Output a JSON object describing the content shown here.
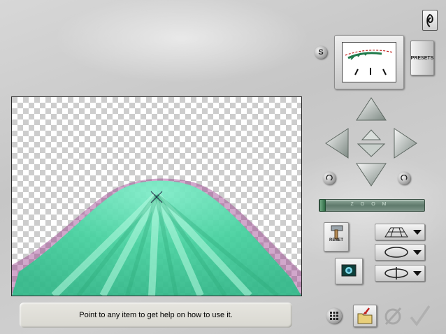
{
  "help": {
    "text": "Point to any item to get help on how to use it."
  },
  "toolbar": {
    "s_label": "S",
    "presets_label": "PRESETS",
    "reset_label": "RESET",
    "zoom_label": "ZOOM"
  },
  "colors": {
    "beam_green": "#4fe8b0",
    "beam_edge_purple": "#9a3c8c",
    "zoom_track": "#6b877a",
    "accent_red": "#c0201c"
  },
  "icons": {
    "logo": "spiral-logo-icon",
    "up": "arrow-up-icon",
    "down": "arrow-down-icon",
    "left": "arrow-left-icon",
    "right": "arrow-right-icon",
    "forward": "move-forward-icon",
    "back": "move-back-icon",
    "rotate_left": "rotate-left-icon",
    "rotate_right": "rotate-right-icon",
    "hammer": "hammer-icon",
    "perspective": "perspective-grid-icon",
    "rotate_flat": "rotation-ellipse-icon",
    "rotate_vertical": "vertical-rotation-icon",
    "background": "background-color-icon",
    "grid": "grid-icon",
    "open": "open-folder-icon",
    "cancel": "cancel-icon",
    "ok": "checkmark-icon"
  }
}
